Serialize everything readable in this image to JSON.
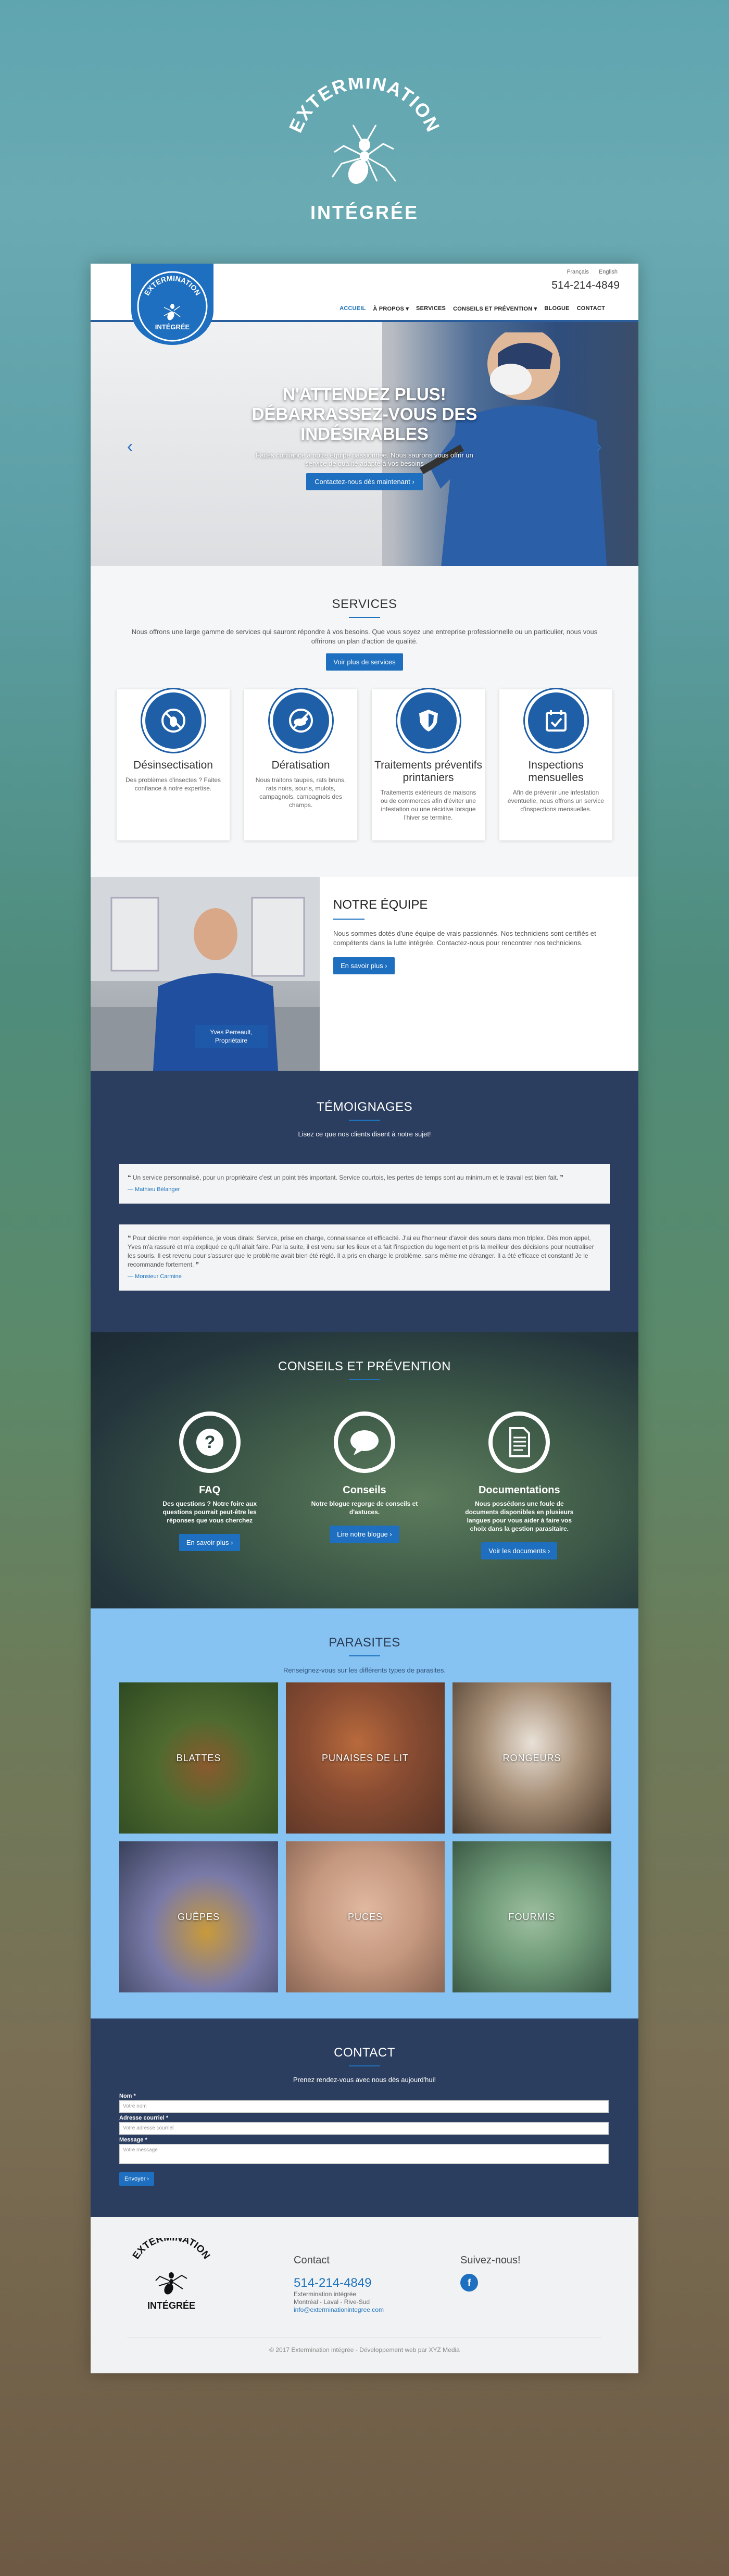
{
  "brand": {
    "name_top": "EXTERMINATION",
    "name_bottom": "INTÉGRÉE"
  },
  "header": {
    "lang_fr": "Français",
    "lang_en": "English",
    "phone": "514-214-4849",
    "nav": [
      "ACCUEIL",
      "À PROPOS ▾",
      "SERVICES",
      "CONSEILS ET PRÉVENTION ▾",
      "BLOGUE",
      "CONTACT"
    ]
  },
  "hero": {
    "title_1": "N'ATTENDEZ PLUS!",
    "title_2": "DÉBARRASSEZ-VOUS DES",
    "title_3": "INDÉSIRABLES",
    "subtitle": "Faites confiance à notre équipe passionnée. Nous saurons vous offrir un service de qualité adapté à vos besoins",
    "button": "Contactez-nous dès maintenant ›",
    "prev": "‹",
    "next": "›"
  },
  "services": {
    "title": "SERVICES",
    "description": "Nous offrons une large gamme de services qui sauront répondre à vos besoins. Que vous soyez une entreprise professionnelle ou un particulier, nous vous offrirons un plan d'action de qualité.",
    "button": "Voir plus de services",
    "cards": [
      {
        "title": "Désinsectisation",
        "text": "Des problèmes d'insectes ? Faites confiance à notre expertise."
      },
      {
        "title": "Dératisation",
        "text": "Nous traitons taupes, rats bruns, rats noirs, souris, mulots, campagnols, campagnols des champs."
      },
      {
        "title": "Traitements préventifs printaniers",
        "text": "Traitements extérieurs de maisons ou de commerces afin d'éviter une infestation ou une récidive lorsque l'hiver se termine."
      },
      {
        "title": "Inspections mensuelles",
        "text": "Afin de prévenir une infestation éventuelle, nous offrons un service d'inspections mensuelles."
      }
    ]
  },
  "team": {
    "title": "NOTRE ÉQUIPE",
    "text": "Nous sommes dotés d'une équipe de vrais passionnés. Nos techniciens sont certifiés et compétents dans la lutte intégrée. Contactez-nous pour rencontrer nos techniciens.",
    "button": "En savoir plus ›",
    "caption_name": "Yves Perreault,",
    "caption_role": "Propriétaire"
  },
  "testimonials": {
    "title": "TÉMOIGNAGES",
    "subtitle": "Lisez ce que nos clients disent à notre sujet!",
    "items": [
      {
        "text": "❝ Un service personnalisé, pour un propriétaire c'est un point très important. Service courtois, les pertes de temps sont au minimum et le travail est bien fait. ❞",
        "author": "— Mathieu Bélanger"
      },
      {
        "text": "❝ Pour décrire mon expérience, je vous dirais: Service, prise en charge, connaissance et efficacité. J'ai eu l'honneur d'avoir des sours dans mon triplex. Dès mon appel, Yves m'a rassuré et m'a expliqué ce qu'il allait faire. Par la suite, il est venu sur les lieux et a fait l'inspection du logement et pris la meilleur des décisions pour neutraliser les souris. Il est revenu pour s'assurer que le problème avait bien été réglé. Il a pris en charge le problème, sans même me déranger. Il a été efficace et constant! Je le recommande fortement. ❞",
        "author": "— Monsieur Carmine"
      }
    ]
  },
  "conseils": {
    "title": "CONSEILS ET PRÉVENTION",
    "cols": [
      {
        "title": "FAQ",
        "text": "Des questions ? Notre foire aux questions pourrait peut-être les réponses que vous cherchez",
        "button": "En savoir plus ›",
        "icon": "question-icon"
      },
      {
        "title": "Conseils",
        "text": "Notre blogue regorge de conseils et d'astuces.",
        "button": "Lire notre blogue ›",
        "icon": "speech-bubble-icon"
      },
      {
        "title": "Documentations",
        "text": "Nous possédons une foule de documents disponibles en plusieurs langues pour vous aider à faire vos choix dans la gestion parasitaire.",
        "button": "Voir les documents ›",
        "icon": "document-icon"
      }
    ]
  },
  "parasites": {
    "title": "PARASITES",
    "subtitle": "Renseignez-vous sur les différents types de parasites.",
    "tiles": [
      "BLATTES",
      "PUNAISES DE LIT",
      "RONGEURS",
      "GUÊPES",
      "PUCES",
      "FOURMIS"
    ]
  },
  "contact": {
    "title": "CONTACT",
    "subtitle": "Prenez rendez-vous avec nous dès aujourd'hui!",
    "name_label": "Nom *",
    "name_placeholder": "Votre nom",
    "email_label": "Adresse courriel *",
    "email_placeholder": "Votre adresse courriel",
    "message_label": "Message *",
    "message_placeholder": "Votre message",
    "submit": "Envoyer ›"
  },
  "footer": {
    "contact_title": "Contact",
    "phone": "514-214-4849",
    "company": "Extermination intégrée",
    "region": "Montréal - Laval - Rive-Sud",
    "email": "info@exterminationintegree.com",
    "social_title": "Suivez-nous!",
    "facebook": "f",
    "copyright": "© 2017 Extermination intégrée - Développement web par XYZ Media"
  },
  "colors": {
    "primary": "#1e6fbf",
    "navy": "#2c3e5f",
    "light_blue": "#87c3f2"
  }
}
